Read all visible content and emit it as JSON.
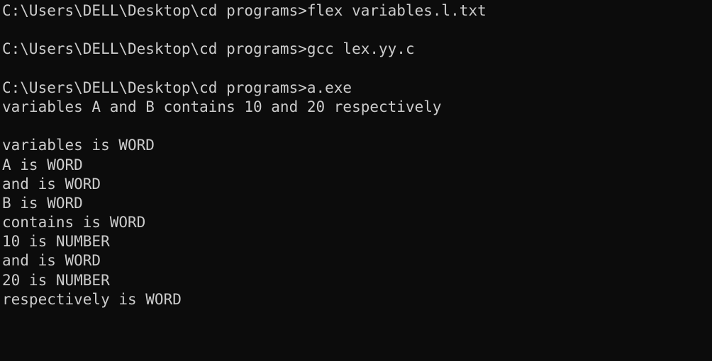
{
  "console": {
    "lines": [
      "C:\\Users\\DELL\\Desktop\\cd programs>flex variables.l.txt",
      "",
      "C:\\Users\\DELL\\Desktop\\cd programs>gcc lex.yy.c",
      "",
      "C:\\Users\\DELL\\Desktop\\cd programs>a.exe",
      "variables A and B contains 10 and 20 respectively",
      "",
      "variables is WORD",
      "A is WORD",
      "and is WORD",
      "B is WORD",
      "contains is WORD",
      "10 is NUMBER",
      "and is WORD",
      "20 is NUMBER",
      "respectively is WORD"
    ]
  },
  "colors": {
    "background": "#0c0c0c",
    "foreground": "#cccccc"
  }
}
